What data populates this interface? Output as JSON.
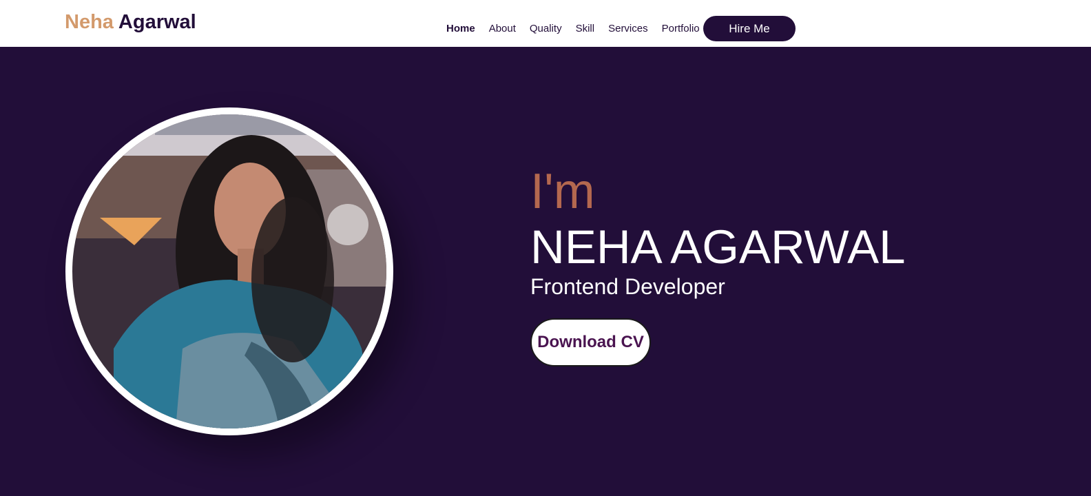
{
  "header": {
    "logo": {
      "first": "Neha",
      "last": "Agarwal"
    },
    "nav": [
      {
        "label": "Home",
        "active": true
      },
      {
        "label": "About"
      },
      {
        "label": "Quality"
      },
      {
        "label": "Skill"
      },
      {
        "label": "Services"
      },
      {
        "label": "Portfolio"
      }
    ],
    "hire_label": "Hire Me"
  },
  "hero": {
    "greeting": "I'm",
    "name": "NEHA AGARWAL",
    "role": "Frontend Developer",
    "cv_label": "Download CV",
    "photo_alt": "Neha Agarwal portrait"
  },
  "colors": {
    "brand_dark": "#220e39",
    "accent_tan": "#d39a6c",
    "greeting": "#b4684f",
    "cv_text": "#4a1450"
  }
}
